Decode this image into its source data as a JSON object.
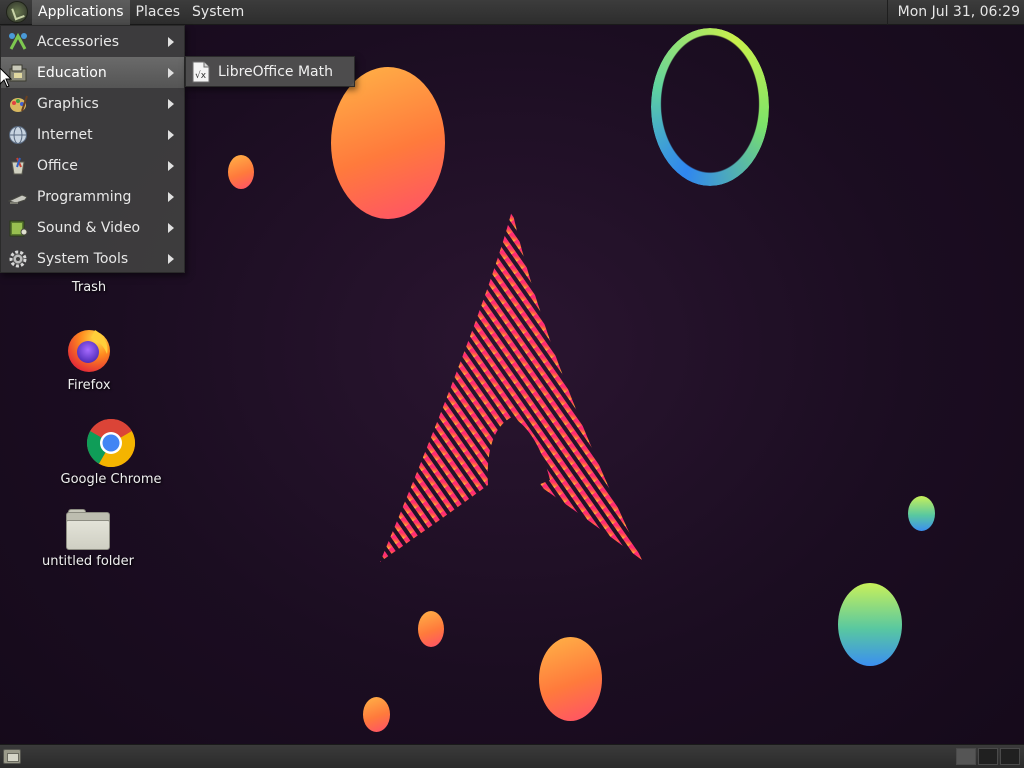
{
  "top_panel": {
    "menus": [
      "Applications",
      "Places",
      "System"
    ],
    "clock": "Mon Jul 31, 06:29"
  },
  "applications_menu": {
    "items": [
      {
        "label": "Accessories",
        "icon": "accessories-icon"
      },
      {
        "label": "Education",
        "icon": "education-icon"
      },
      {
        "label": "Graphics",
        "icon": "graphics-icon"
      },
      {
        "label": "Internet",
        "icon": "internet-icon"
      },
      {
        "label": "Office",
        "icon": "office-icon"
      },
      {
        "label": "Programming",
        "icon": "programming-icon"
      },
      {
        "label": "Sound & Video",
        "icon": "sound-video-icon"
      },
      {
        "label": "System Tools",
        "icon": "system-tools-icon"
      }
    ],
    "active_index": 1
  },
  "education_submenu": {
    "items": [
      {
        "label": "LibreOffice Math",
        "icon": "libreoffice-math-icon"
      }
    ]
  },
  "desktop_icons": [
    {
      "label": "Trash",
      "icon": "trash-icon"
    },
    {
      "label": "Firefox",
      "icon": "firefox-icon"
    },
    {
      "label": "Google Chrome",
      "icon": "chrome-icon"
    },
    {
      "label": "untitled folder",
      "icon": "folder-icon"
    }
  ],
  "colors": {
    "panel": "#2d2d2d",
    "desktop_bg": "#1b0d21",
    "menu_bg": "#404040",
    "menu_active": "#5e5e5e"
  }
}
